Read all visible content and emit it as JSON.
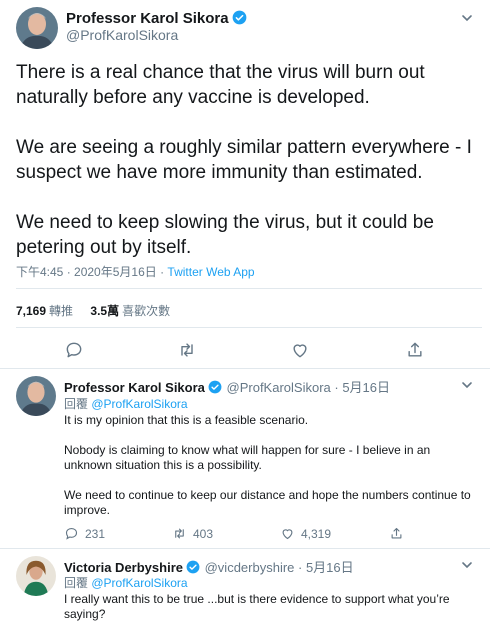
{
  "main_tweet": {
    "author_name": "Professor Karol Sikora",
    "author_handle": "@ProfKarolSikora",
    "paragraphs": [
      "There is a real chance that the virus will burn out naturally before any vaccine is developed.",
      "We are seeing a roughly similar pattern everywhere - I suspect we have more immunity than estimated.",
      "We need to keep slowing the virus, but it could be petering out by itself."
    ],
    "timestamp": "下午4:45 · 2020年5月16日 · ",
    "source": "Twitter Web App",
    "retweets_count": "7,169",
    "retweets_label": "轉推",
    "likes_count": "3.5萬",
    "likes_label": "喜歡次數"
  },
  "replies": [
    {
      "author_name": "Professor Karol Sikora",
      "author_handle": "@ProfKarolSikora",
      "date": " · 5月16日",
      "replying_prefix": "回覆 ",
      "replying_to": "@ProfKarolSikora",
      "paragraphs": [
        "It is my opinion that this is a feasible scenario.",
        "Nobody is claiming to know what will happen for sure - I believe in an unknown situation this is a possibility.",
        "We need to continue to keep our distance and hope the numbers continue to improve."
      ],
      "reply_count": "231",
      "retweet_count": "403",
      "like_count": "4,319"
    },
    {
      "author_name": "Victoria Derbyshire",
      "author_handle": "@vicderbyshire",
      "date": " · 5月16日",
      "replying_prefix": "回覆 ",
      "replying_to": "@ProfKarolSikora",
      "paragraphs": [
        "I really want this to be true ...but  is there evidence to support what you’re saying?"
      ]
    }
  ],
  "colors": {
    "accent": "#1da1f2",
    "muted": "#657786",
    "text": "#14171a",
    "border": "#e1e8ed"
  }
}
